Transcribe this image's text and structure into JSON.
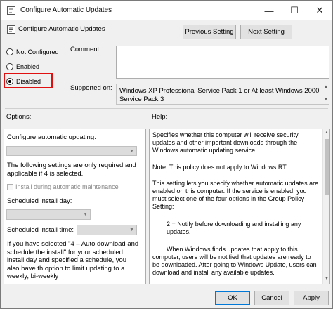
{
  "window": {
    "title": "Configure Automatic Updates",
    "minimize_glyph": "—",
    "maximize_glyph": "☐",
    "close_glyph": "✕"
  },
  "header": {
    "policy_title": "Configure Automatic Updates",
    "previous_label": "Previous Setting",
    "next_label": "Next Setting"
  },
  "state": {
    "not_configured": "Not Configured",
    "enabled": "Enabled",
    "disabled": "Disabled",
    "selected": "Disabled"
  },
  "comment_label": "Comment:",
  "comment_value": "",
  "supported_label": "Supported on:",
  "supported_value": "Windows XP Professional Service Pack 1 or At least Windows 2000 Service Pack 3",
  "options": {
    "label": "Options:",
    "configure_label": "Configure automatic updating:",
    "configure_value": "",
    "following_note": "The following settings are only required and applicable if 4 is selected.",
    "maintenance_label": "Install during automatic maintenance",
    "day_label": "Scheduled install day:",
    "day_value": "",
    "time_label": "Scheduled install time:",
    "time_value": "",
    "bottom_text": "If you have selected \"4 – Auto download and schedule the install\" for your scheduled install day and specified a schedule, you also have th option to limit updating to a weekly, bi-weekly"
  },
  "help": {
    "label": "Help:",
    "p1": "Specifies whether this computer will receive security updates and other important downloads through the Windows automatic updating service.",
    "p2": "Note: This policy does not apply to Windows RT.",
    "p3": "This setting lets you specify whether automatic updates are enabled on this computer. If the service is enabled, you must select one of the four options in the Group Policy Setting:",
    "p4": "2 = Notify before downloading and installing any updates.",
    "p5": "When Windows finds updates that apply to this computer, users will be notified that updates are ready to be downloaded. After going to Windows Update, users can download and install any available updates."
  },
  "footer": {
    "ok": "OK",
    "cancel": "Cancel",
    "apply": "Apply"
  },
  "colors": {
    "highlight": "#e01010",
    "focus": "#0078d7"
  },
  "icons": [
    "policy-icon",
    "minimize-icon",
    "maximize-icon",
    "close-icon",
    "scroll-up-icon",
    "scroll-down-icon",
    "dropdown-arrow-icon"
  ]
}
